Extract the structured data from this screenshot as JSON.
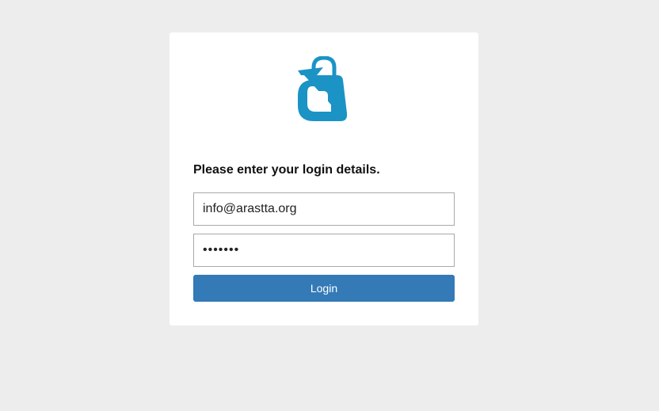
{
  "login": {
    "logo_icon": "shopping-bag-a-logo",
    "brand_color": "#1b93c5",
    "heading": "Please enter your login details.",
    "email": {
      "value": "info@arastta.org",
      "placeholder": ""
    },
    "password": {
      "value": "1234567",
      "placeholder": ""
    },
    "button_label": "Login",
    "button_color": "#337ab7"
  }
}
